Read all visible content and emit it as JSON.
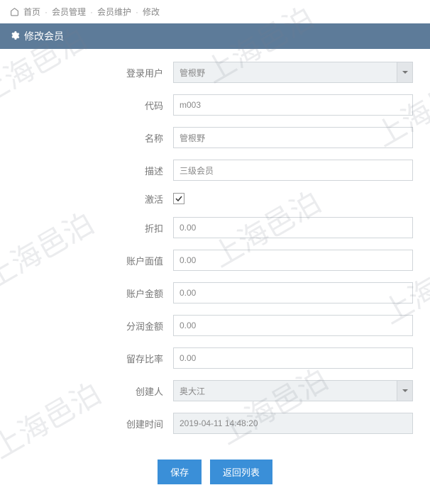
{
  "watermark_text": "上海邑泊",
  "breadcrumb": {
    "home": "首页",
    "member_mgmt": "会员管理",
    "member_maint": "会员维护",
    "modify": "修改"
  },
  "panel_title": "修改会员",
  "labels": {
    "login_user": "登录用户",
    "code": "代码",
    "name": "名称",
    "description": "描述",
    "active": "激活",
    "discount": "折扣",
    "account_face_value": "账户面值",
    "account_amount": "账户金额",
    "commission_amount": "分润金额",
    "retention_rate": "留存比率",
    "creator": "创建人",
    "create_time": "创建时间"
  },
  "values": {
    "login_user": "管根野",
    "code": "m003",
    "name": "管根野",
    "description": "三级会员",
    "active": true,
    "discount": "0.00",
    "account_face_value": "0.00",
    "account_amount": "0.00",
    "commission_amount": "0.00",
    "retention_rate": "0.00",
    "creator": "奥大江",
    "create_time": "2019-04-11 14:48:20"
  },
  "buttons": {
    "save": "保存",
    "return_list": "返回列表"
  }
}
